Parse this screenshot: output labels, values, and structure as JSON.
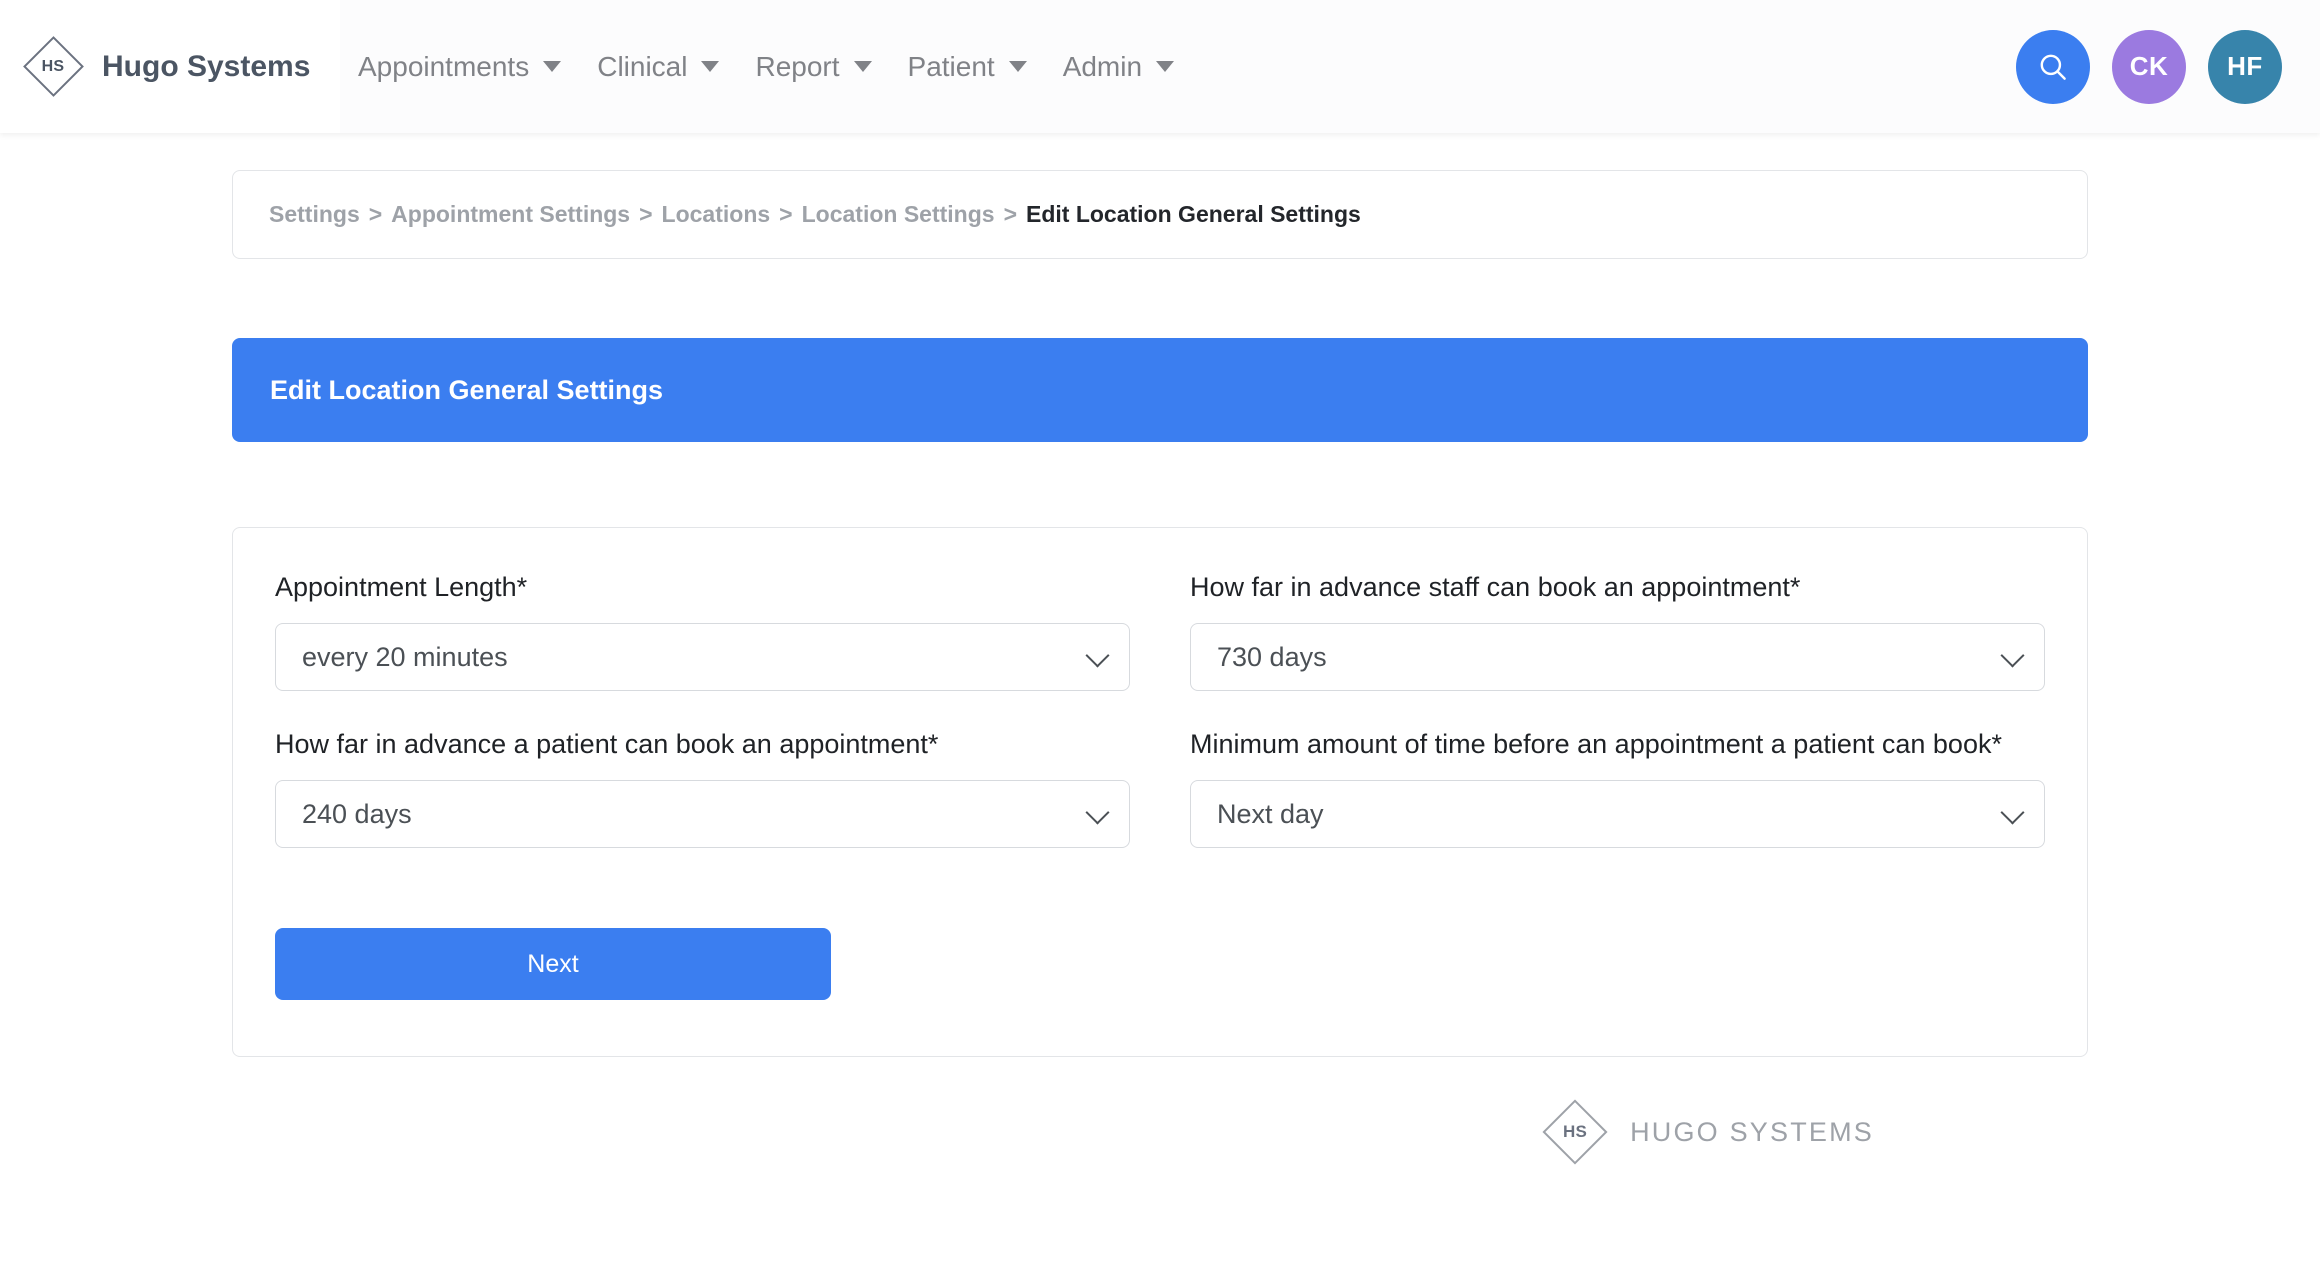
{
  "header": {
    "logo_text": "HS",
    "brand_name": "Hugo Systems",
    "nav_items": [
      {
        "label": "Appointments"
      },
      {
        "label": "Clinical"
      },
      {
        "label": "Report"
      },
      {
        "label": "Patient"
      },
      {
        "label": "Admin"
      }
    ],
    "actions": {
      "search_icon": "search-icon",
      "avatar_one": "CK",
      "avatar_two": "HF"
    },
    "colors": {
      "search_bg": "#3b7ef0",
      "avatar_one_bg": "#9b7ae0",
      "avatar_two_bg": "#3784ab"
    }
  },
  "breadcrumb": {
    "separator": ">",
    "items": [
      {
        "label": "Settings",
        "current": false
      },
      {
        "label": "Appointment Settings",
        "current": false
      },
      {
        "label": "Locations",
        "current": false
      },
      {
        "label": "Location Settings",
        "current": false
      },
      {
        "label": "Edit Location General Settings",
        "current": true
      }
    ]
  },
  "banner": {
    "title": "Edit Location General Settings",
    "background": "#3b7ef0"
  },
  "form": {
    "fields": {
      "appointment_length": {
        "label": "Appointment Length*",
        "value": "every 20 minutes"
      },
      "staff_advance_booking": {
        "label": "How far in advance staff can book an appointment*",
        "value": "730 days"
      },
      "patient_advance_booking": {
        "label": "How far in advance a patient can book an appointment*",
        "value": "240 days"
      },
      "minimum_lead_time": {
        "label": "Minimum amount of time before an appointment a patient can book*",
        "value": "Next day"
      }
    },
    "next_button": "Next"
  },
  "footer": {
    "logo_text": "HS",
    "brand_name": "HUGO SYSTEMS"
  }
}
